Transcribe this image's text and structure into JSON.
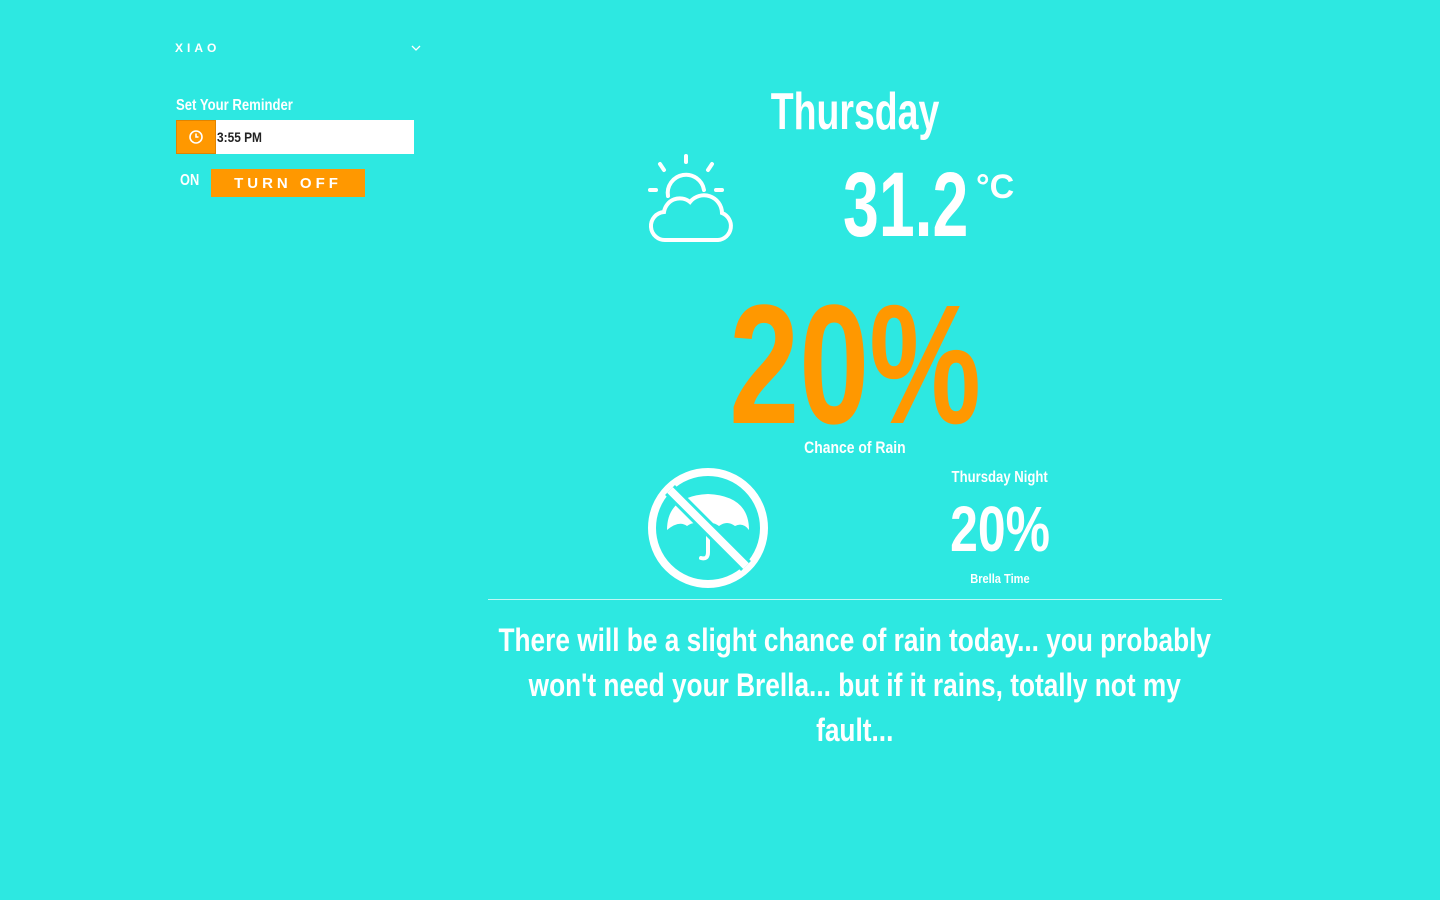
{
  "user": {
    "name": "XIAO"
  },
  "reminder": {
    "label": "Set Your Reminder",
    "time": "3:55 PM",
    "status": "ON",
    "toggle_label": "TURN OFF"
  },
  "forecast": {
    "day": "Thursday",
    "temperature": "31.2",
    "unit": "°C",
    "weather_icon": "partly-cloudy-icon",
    "rain_chance": "20%",
    "rain_caption": "Chance of Rain",
    "umbrella_icon": "no-umbrella-icon",
    "night_label": "Thursday Night",
    "night_rain_chance": "20%",
    "night_caption": "Brella Time",
    "message": "There will be a slight chance of rain today... you probably won't need your Brella... but if it rains, totally not my fault..."
  },
  "colors": {
    "background": "#2de8e1",
    "accent": "#ff9800",
    "text": "#ffffff"
  }
}
